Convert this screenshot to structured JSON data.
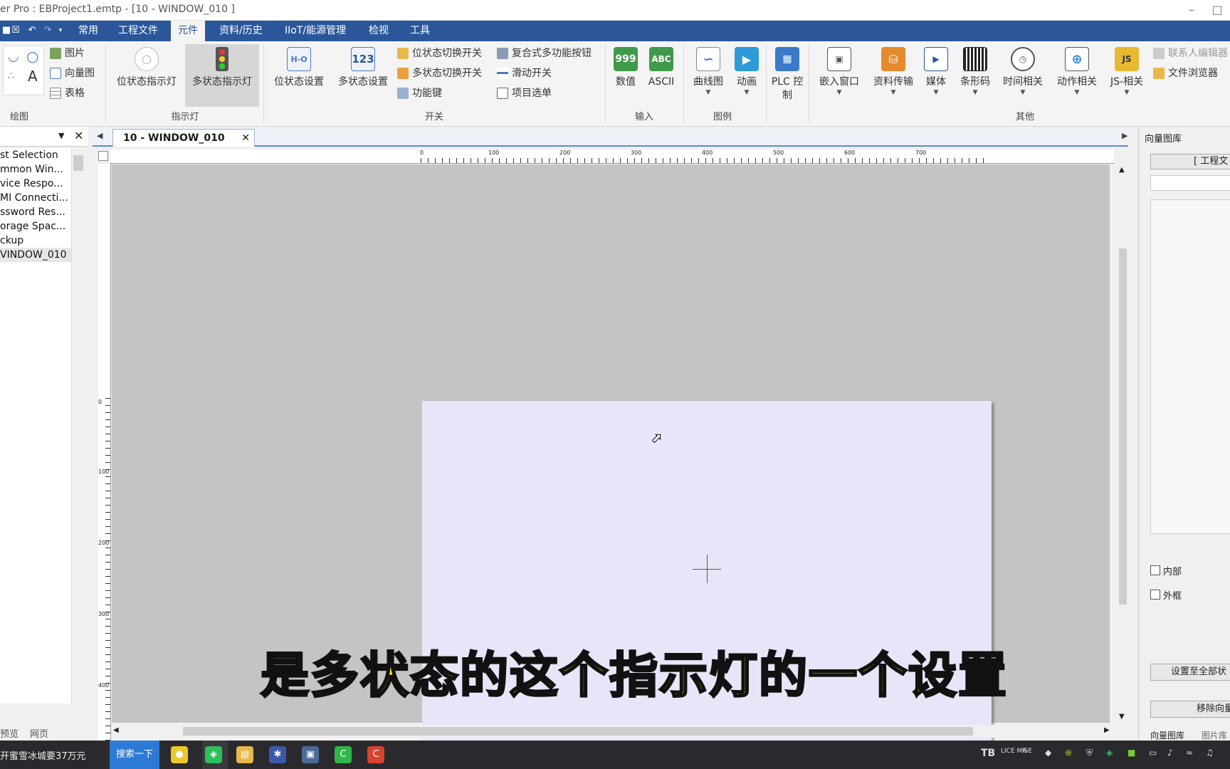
{
  "window": {
    "title": "er Pro : EBProject1.emtp - [10 - WINDOW_010 ]"
  },
  "menubar": {
    "items": [
      "常用",
      "工程文件",
      "元件",
      "资料/历史",
      "IIoT/能源管理",
      "检视",
      "工具"
    ],
    "active": "元件"
  },
  "ribbon": {
    "drawing": {
      "group_label": "绘图",
      "items": [
        "图片",
        "向量图",
        "表格"
      ]
    },
    "indicator": {
      "group_label": "指示灯",
      "buttons": [
        "位状态指示灯",
        "多状态指示灯"
      ]
    },
    "switch": {
      "group_label": "开关",
      "big_buttons": [
        "位状态设置",
        "多状态设置"
      ],
      "small_col1": [
        "位状态切换开关",
        "多状态切换开关",
        "功能键"
      ],
      "small_col2": [
        "复合式多功能按钮",
        "滑动开关",
        "项目选单"
      ]
    },
    "input": {
      "group_label": "输入",
      "buttons": [
        "数值",
        "ASCII"
      ],
      "icons": [
        "999",
        "ABC"
      ]
    },
    "legend": {
      "group_label": "图例",
      "buttons": [
        "曲线图",
        "动画"
      ]
    },
    "plc": {
      "button": "PLC 控制"
    },
    "other": {
      "group_label": "其他",
      "buttons": [
        "嵌入窗口",
        "资料传输",
        "媒体",
        "条形码",
        "时间相关",
        "动作相关",
        "JS-相关"
      ],
      "small": [
        "联系人编辑器",
        "文件浏览器"
      ],
      "js_icon": "JS"
    }
  },
  "left_panel": {
    "items": [
      "st Selection",
      "mmon Win...",
      "vice Respo...",
      "MI Connecti...",
      "ssword Res...",
      "orage Spac...",
      "ckup",
      "VINDOW_010"
    ],
    "bottom_tabs": [
      "预览",
      "网页"
    ]
  },
  "document": {
    "tab": "10 - WINDOW_010",
    "hruler_labels": [
      "0",
      "100",
      "200",
      "300",
      "400",
      "500",
      "600",
      "700"
    ],
    "vruler_labels": [
      "0",
      "100",
      "200",
      "300",
      "400"
    ]
  },
  "right_panel": {
    "title": "向量图库",
    "project_btn": "[ 工程文",
    "chk_inner": "内部",
    "chk_frame": "外框",
    "btn_set_all": "设置至全部状",
    "btn_remove": "移除向量",
    "tabs": [
      "向量图库",
      "图片库"
    ]
  },
  "subtitle": "是多状态的这个指示灯的一个设置",
  "taskbar": {
    "news": "开蜜雪冰城要37万元",
    "search": "搜索一下",
    "tray": [
      "LICE MA",
      "ISE"
    ]
  }
}
